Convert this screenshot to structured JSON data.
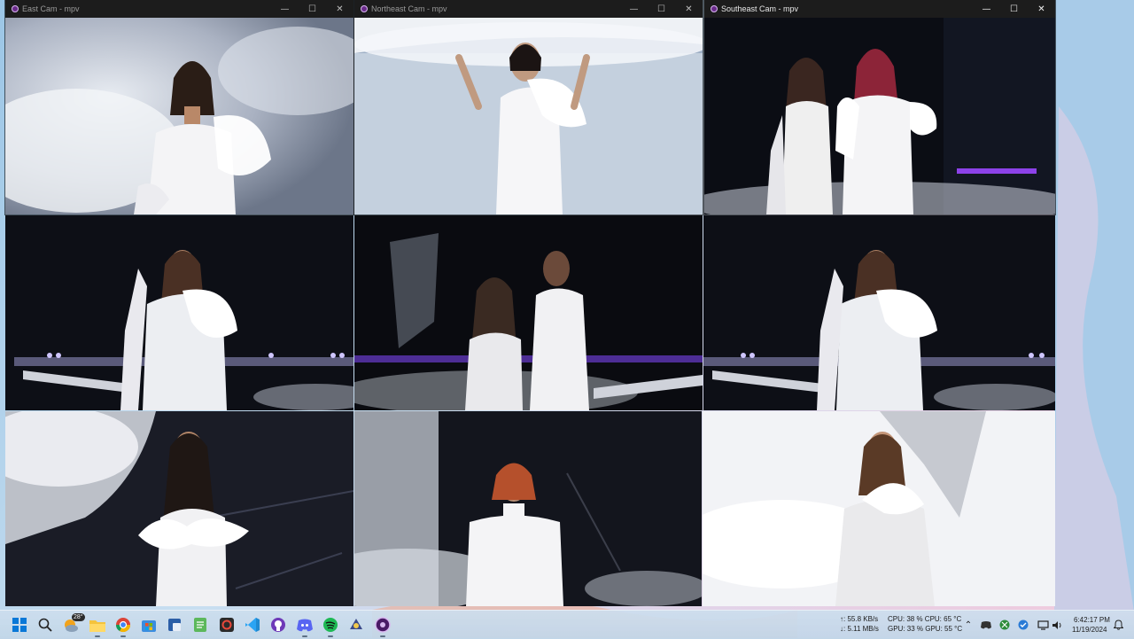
{
  "windows": [
    {
      "title": "East Cam - mpv"
    },
    {
      "title": "Northeast Cam - mpv"
    },
    {
      "title": "Southeast Cam - mpv"
    }
  ],
  "window_controls": {
    "minimize": "—",
    "maximize": "☐",
    "close": "✕"
  },
  "taskbar": {
    "weather": "28°",
    "net_up": "↑: 55.8 KB/s",
    "net_down": "↓: 5.11 MB/s",
    "cpu": "CPU: 38 %  CPU: 65 °C",
    "gpu": "GPU: 33 %  GPU: 55 °C",
    "time": "6:42:17 PM",
    "date": "11/19/2024",
    "icons": [
      "windows-start-icon",
      "search-icon",
      "weather-widget-icon",
      "file-explorer-icon",
      "chrome-icon",
      "microsoft-store-icon",
      "snipping-tool-icon",
      "notepad-icon",
      "davinci-resolve-icon",
      "vscode-icon",
      "github-icon",
      "discord-icon",
      "spotify-icon",
      "game-tool-icon",
      "mpv-icon"
    ]
  },
  "colors": {
    "accent": "#1c1c1c",
    "mpv_icon": "#6a2a8a"
  }
}
